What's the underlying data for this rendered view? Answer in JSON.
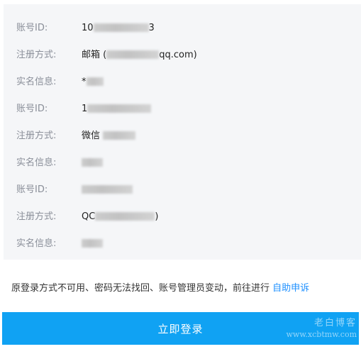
{
  "accounts": [
    {
      "id_label": "账号ID:",
      "id_value_prefix": "10",
      "id_value_suffix": "3",
      "reg_label": "注册方式:",
      "reg_value_prefix": "邮箱 (",
      "reg_value_suffix": "qq.com)",
      "name_label": "实名信息:",
      "name_value_prefix": "*"
    },
    {
      "id_label": "账号ID:",
      "id_value_prefix": "1",
      "id_value_suffix": "",
      "reg_label": "注册方式:",
      "reg_value_prefix": "微信",
      "reg_value_suffix": "",
      "name_label": "实名信息:",
      "name_value_prefix": ""
    },
    {
      "id_label": "账号ID:",
      "id_value_prefix": "",
      "id_value_suffix": "",
      "reg_label": "注册方式:",
      "reg_value_prefix": "QC",
      "reg_value_suffix": ")",
      "name_label": "实名信息:",
      "name_value_prefix": ""
    }
  ],
  "notice": {
    "text": "原登录方式不可用、密码无法找回、账号管理员变动，前往进行",
    "link": "自助申诉"
  },
  "login_button": "立即登录",
  "watermark": {
    "top": "老白博客",
    "bottom": "www.xcbtmw.com"
  },
  "colors": {
    "panel_bg": "#f5f6f8",
    "button_bg": "#10a2f3",
    "link": "#1e90ff",
    "label": "#8a8f99"
  }
}
